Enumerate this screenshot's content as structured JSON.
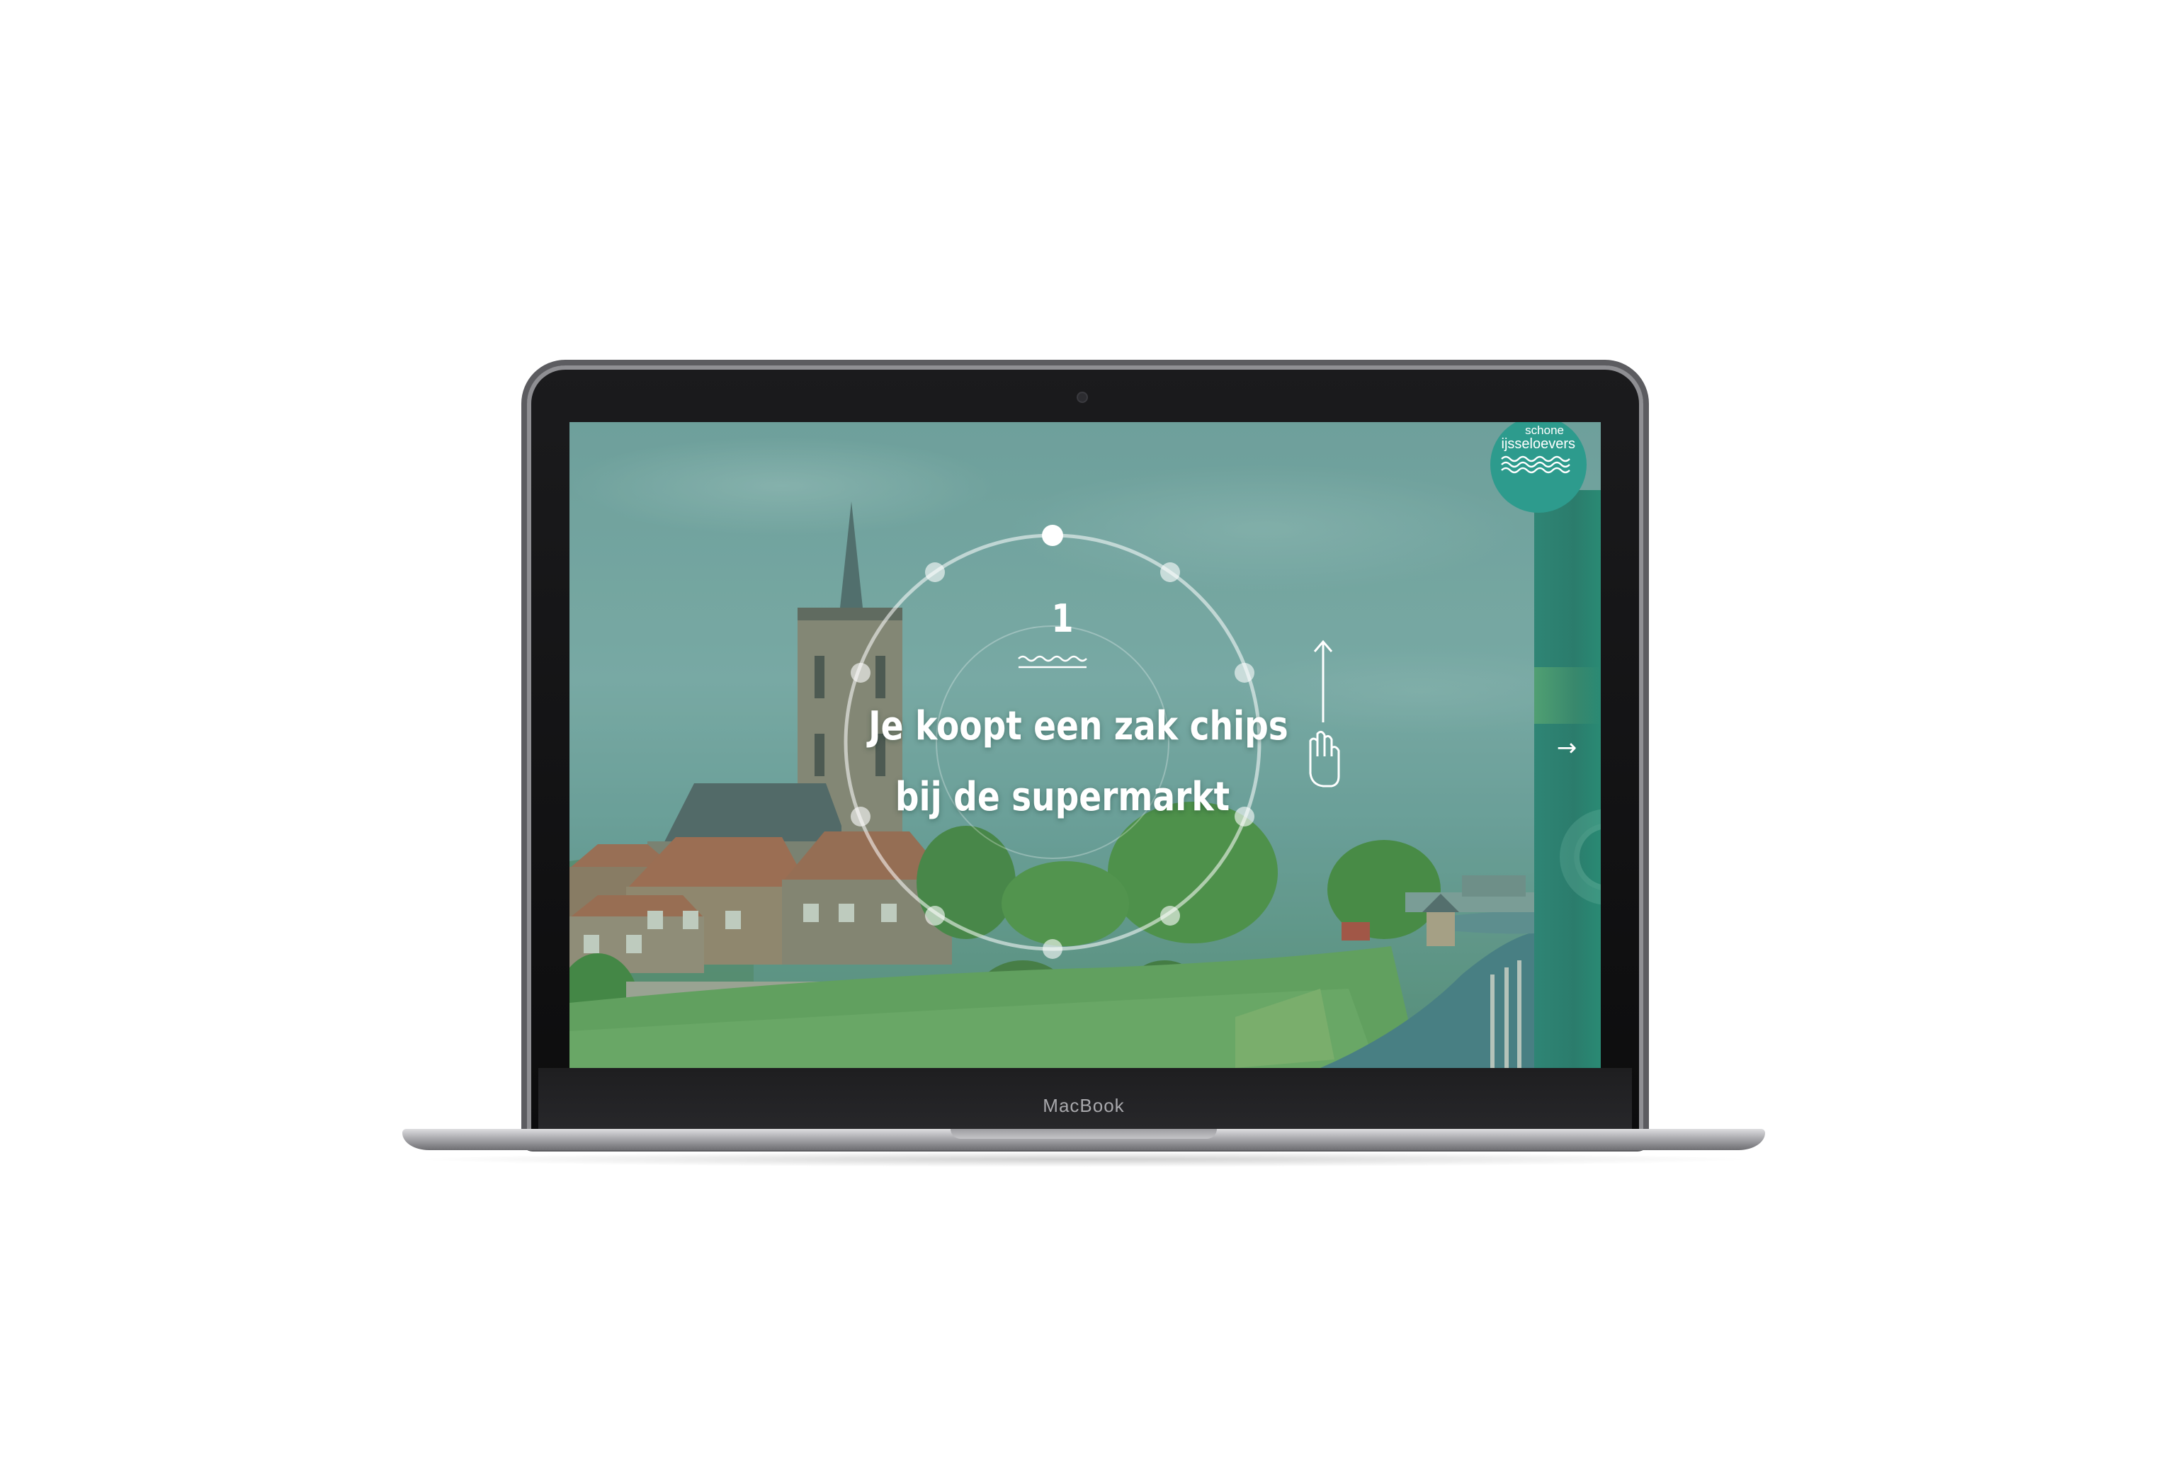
{
  "device": {
    "brand_label": "MacBook"
  },
  "logo": {
    "line1": "schone",
    "line2": "ijsseloevers"
  },
  "slide": {
    "step_number": "1",
    "headline_line1": "Je koopt een zak chips",
    "headline_line2": "bij de supermarkt"
  },
  "navigation": {
    "next_arrow": "→"
  },
  "icons": {
    "waves": "waves-icon",
    "swipe_arrow": "arrow-up-icon",
    "hand": "hand-icon",
    "next": "arrow-right-icon"
  },
  "colors": {
    "overlay_tint": "#348074",
    "panel": "#2b7c6c",
    "logo_badge": "#2d9b8d",
    "text": "#ffffff"
  }
}
